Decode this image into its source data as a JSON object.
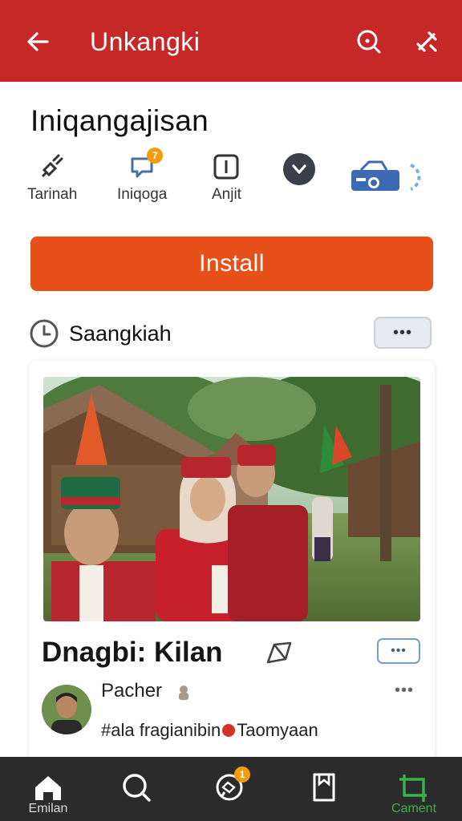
{
  "appbar": {
    "title": "Unkangki",
    "back_icon": "arrow-left-icon",
    "search_icon": "search-icon",
    "tools_icon": "tools-icon",
    "color": "#c62828"
  },
  "page": {
    "title": "Iniqangajisan"
  },
  "actions": [
    {
      "label": "Tarinah",
      "icon": "satellite-icon"
    },
    {
      "label": "Iniqoga",
      "icon": "comment-icon",
      "badge": "7"
    },
    {
      "label": "Anjit",
      "icon": "pause-icon"
    },
    {
      "label": "",
      "icon": "heart-icon"
    },
    {
      "label": "",
      "icon": "projector-icon"
    }
  ],
  "install": {
    "label": "Install",
    "color": "#e8501a"
  },
  "section": {
    "title": "Saangkiah",
    "more": "•••"
  },
  "post": {
    "title": "Dnagbi: Kilan",
    "more": "•••",
    "author": "Pacher",
    "author_more": "•••",
    "tags_before": "#ala fragianibin",
    "tags_after": "Taomyaan"
  },
  "nav": [
    {
      "label": "Emilan",
      "icon": "home-icon"
    },
    {
      "label": "",
      "icon": "search-icon"
    },
    {
      "label": "",
      "icon": "chat-icon",
      "badge": "1"
    },
    {
      "label": "",
      "icon": "bookmark-icon"
    },
    {
      "label": "Cament",
      "icon": "crop-icon",
      "active": true
    }
  ]
}
